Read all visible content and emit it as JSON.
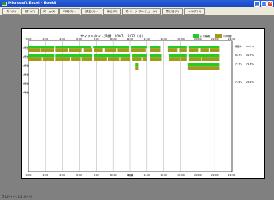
{
  "window": {
    "title": "Microsoft Excel - Book3",
    "status": "プレビュー: 1/1 ページ"
  },
  "toolbar": {
    "buttons": [
      "次へ(N)",
      "前へ(P)",
      "ズーム(Z)",
      "印刷(T)...",
      "設定(S)...",
      "余白(M)",
      "改ページ プレビュー(V)",
      "閉じる(C)",
      "ヘルプ(H)"
    ]
  },
  "colors": {
    "machine_running": "#22cc22",
    "machine_stopped": "#a49a1a",
    "titlebar": "#1f53d1"
  },
  "chart_data": {
    "type": "bar",
    "title": "サイクルタイム実績　2007/　8/22（水）",
    "legend": [
      "ｶﾞｽ稼働",
      "ﾛｽ時間"
    ],
    "xlabel": "時刻",
    "x_ticks": [
      "0:00",
      "2:00",
      "4:00",
      "6:00",
      "8:00",
      "10:00",
      "12:00",
      "14:00",
      "16:00",
      "18:00",
      "20:00",
      "22:00",
      "24:00"
    ],
    "xlim": [
      0,
      24
    ],
    "categories": [
      "1号機",
      "2号機",
      "3号機",
      "4号機",
      "5号機",
      "6号機"
    ],
    "stats": [
      [
        "稼働率",
        "95.7%"
      ],
      [
        "88.7%",
        "91.7%"
      ],
      [
        "77.7%",
        "71.3%"
      ],
      [
        "",
        ""
      ],
      [
        "75.9%",
        "24.6%"
      ]
    ],
    "series": [
      {
        "name": "ｶﾞｽ稼働",
        "row": 0,
        "segments": [
          [
            0,
            3.1
          ],
          [
            3.2,
            7.4
          ],
          [
            7.6,
            11.9
          ],
          [
            12.1,
            14.0
          ],
          [
            14.4,
            15.6
          ],
          [
            16.5,
            18.7
          ],
          [
            18.9,
            22.5
          ]
        ]
      },
      {
        "name": "ﾛｽ時間",
        "row": 0,
        "segments": [
          [
            0,
            1.4
          ],
          [
            1.5,
            3.0
          ],
          [
            3.2,
            4.7
          ],
          [
            4.8,
            6.3
          ],
          [
            6.5,
            7.5
          ],
          [
            7.7,
            8.8
          ],
          [
            9.0,
            10.4
          ],
          [
            10.5,
            11.9
          ],
          [
            12.1,
            13.8
          ],
          [
            14.4,
            15.6
          ],
          [
            16.5,
            17.6
          ],
          [
            17.8,
            18.7
          ],
          [
            18.9,
            20.1
          ],
          [
            20.3,
            21.3
          ],
          [
            21.4,
            22.5
          ]
        ]
      },
      {
        "name": "ｶﾞｽ稼働",
        "row": 1,
        "segments": [
          [
            0,
            3.1
          ],
          [
            3.2,
            7.5
          ],
          [
            7.7,
            12.0
          ],
          [
            12.2,
            14.0
          ],
          [
            14.3,
            15.7
          ],
          [
            16.6,
            18.7
          ],
          [
            18.9,
            22.5
          ]
        ]
      },
      {
        "name": "ﾛｽ時間",
        "row": 1,
        "segments": [
          [
            0,
            1.6
          ],
          [
            1.7,
            3.0
          ],
          [
            3.2,
            4.9
          ],
          [
            5.0,
            6.2
          ],
          [
            6.3,
            7.5
          ],
          [
            7.7,
            9.2
          ],
          [
            9.4,
            10.7
          ],
          [
            10.9,
            12.0
          ],
          [
            12.2,
            13.4
          ],
          [
            13.5,
            14.0
          ],
          [
            14.3,
            15.7
          ],
          [
            16.6,
            17.9
          ],
          [
            18.0,
            18.7
          ],
          [
            18.9,
            20.4
          ],
          [
            20.5,
            22.5
          ]
        ]
      },
      {
        "name": "ｶﾞｽ稼働",
        "row": 2,
        "segments": [
          [
            12.6,
            13.0
          ],
          [
            18.8,
            22.5
          ]
        ]
      },
      {
        "name": "ﾛｽ時間",
        "row": 2,
        "segments": [
          [
            12.6,
            13.0
          ],
          [
            18.8,
            22.5
          ]
        ]
      }
    ]
  }
}
